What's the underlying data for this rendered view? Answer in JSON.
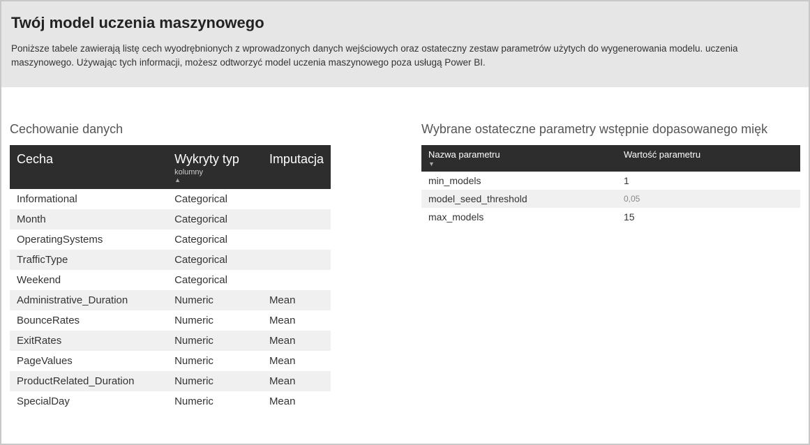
{
  "header": {
    "title": "Twój model uczenia maszynowego",
    "description": "Poniższe tabele zawierają listę cech wyodrębnionych z wprowadzonych danych wejściowych oraz ostateczny zestaw parametrów użytych do wygenerowania modelu. uczenia maszynowego. Używając tych informacji, możesz odtworzyć model uczenia maszynowego poza usługą Power BI."
  },
  "features": {
    "section_title": "Cechowanie danych",
    "columns": {
      "feature": "Cecha",
      "type_main": "Wykryty typ",
      "type_sub": "kolumny",
      "imputation": "Imputacja"
    },
    "rows": [
      {
        "feature": "Informational",
        "type": "Categorical",
        "imputation": ""
      },
      {
        "feature": "Month",
        "type": "Categorical",
        "imputation": ""
      },
      {
        "feature": "OperatingSystems",
        "type": "Categorical",
        "imputation": ""
      },
      {
        "feature": "TrafficType",
        "type": "Categorical",
        "imputation": ""
      },
      {
        "feature": "Weekend",
        "type": "Categorical",
        "imputation": ""
      },
      {
        "feature": "Administrative_Duration",
        "type": "Numeric",
        "imputation": "Mean"
      },
      {
        "feature": "BounceRates",
        "type": "Numeric",
        "imputation": "Mean"
      },
      {
        "feature": "ExitRates",
        "type": "Numeric",
        "imputation": "Mean"
      },
      {
        "feature": "PageValues",
        "type": "Numeric",
        "imputation": "Mean"
      },
      {
        "feature": "ProductRelated_Duration",
        "type": "Numeric",
        "imputation": "Mean"
      },
      {
        "feature": "SpecialDay",
        "type": "Numeric",
        "imputation": "Mean"
      }
    ]
  },
  "params": {
    "section_title": "Wybrane ostateczne parametry wstępnie dopasowanego mięk",
    "columns": {
      "name": "Nazwa parametru",
      "value": "Wartość parametru"
    },
    "rows": [
      {
        "name": "min_models",
        "value": "1"
      },
      {
        "name": "model_seed_threshold",
        "value": "0,05"
      },
      {
        "name": "max_models",
        "value": "15"
      }
    ]
  }
}
